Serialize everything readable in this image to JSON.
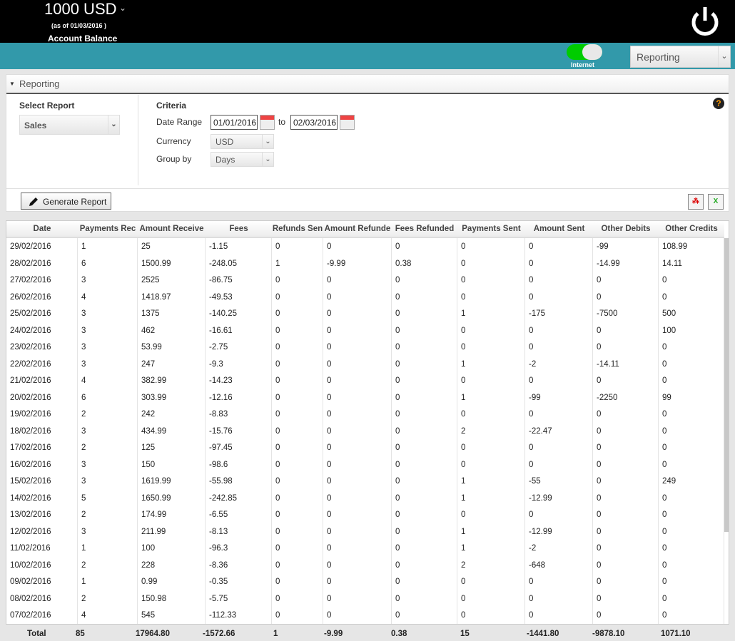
{
  "header": {
    "balance": "1000 USD",
    "as_of": "(as of 01/03/2016 )",
    "balance_label": "Account Balance",
    "internet_label": "Internet",
    "internet_on": true,
    "nav_select": "Reporting"
  },
  "panel": {
    "title": "Reporting",
    "select_report_label": "Select Report",
    "report": "Sales",
    "criteria_label": "Criteria",
    "date_range_label": "Date Range",
    "date_from": "01/01/2016",
    "to_label": "to",
    "date_to": "02/03/2016",
    "currency_label": "Currency",
    "currency": "USD",
    "group_by_label": "Group by",
    "group_by": "Days",
    "generate_label": "Generate Report",
    "help": "?"
  },
  "table": {
    "columns": [
      "Date",
      "Payments Rec",
      "Amount Receive",
      "Fees",
      "Refunds Sen",
      "Amount Refunde",
      "Fees Refunded",
      "Payments Sent",
      "Amount Sent",
      "Other Debits",
      "Other Credits"
    ],
    "rows": [
      [
        "29/02/2016",
        "1",
        "25",
        "-1.15",
        "0",
        "0",
        "0",
        "0",
        "0",
        "-99",
        "108.99"
      ],
      [
        "28/02/2016",
        "6",
        "1500.99",
        "-248.05",
        "1",
        "-9.99",
        "0.38",
        "0",
        "0",
        "-14.99",
        "14.11"
      ],
      [
        "27/02/2016",
        "3",
        "2525",
        "-86.75",
        "0",
        "0",
        "0",
        "0",
        "0",
        "0",
        "0"
      ],
      [
        "26/02/2016",
        "4",
        "1418.97",
        "-49.53",
        "0",
        "0",
        "0",
        "0",
        "0",
        "0",
        "0"
      ],
      [
        "25/02/2016",
        "3",
        "1375",
        "-140.25",
        "0",
        "0",
        "0",
        "1",
        "-175",
        "-7500",
        "500"
      ],
      [
        "24/02/2016",
        "3",
        "462",
        "-16.61",
        "0",
        "0",
        "0",
        "0",
        "0",
        "0",
        "100"
      ],
      [
        "23/02/2016",
        "3",
        "53.99",
        "-2.75",
        "0",
        "0",
        "0",
        "0",
        "0",
        "0",
        "0"
      ],
      [
        "22/02/2016",
        "3",
        "247",
        "-9.3",
        "0",
        "0",
        "0",
        "1",
        "-2",
        "-14.11",
        "0"
      ],
      [
        "21/02/2016",
        "4",
        "382.99",
        "-14.23",
        "0",
        "0",
        "0",
        "0",
        "0",
        "0",
        "0"
      ],
      [
        "20/02/2016",
        "6",
        "303.99",
        "-12.16",
        "0",
        "0",
        "0",
        "1",
        "-99",
        "-2250",
        "99"
      ],
      [
        "19/02/2016",
        "2",
        "242",
        "-8.83",
        "0",
        "0",
        "0",
        "0",
        "0",
        "0",
        "0"
      ],
      [
        "18/02/2016",
        "3",
        "434.99",
        "-15.76",
        "0",
        "0",
        "0",
        "2",
        "-22.47",
        "0",
        "0"
      ],
      [
        "17/02/2016",
        "2",
        "125",
        "-97.45",
        "0",
        "0",
        "0",
        "0",
        "0",
        "0",
        "0"
      ],
      [
        "16/02/2016",
        "3",
        "150",
        "-98.6",
        "0",
        "0",
        "0",
        "0",
        "0",
        "0",
        "0"
      ],
      [
        "15/02/2016",
        "3",
        "1619.99",
        "-55.98",
        "0",
        "0",
        "0",
        "1",
        "-55",
        "0",
        "249"
      ],
      [
        "14/02/2016",
        "5",
        "1650.99",
        "-242.85",
        "0",
        "0",
        "0",
        "1",
        "-12.99",
        "0",
        "0"
      ],
      [
        "13/02/2016",
        "2",
        "174.99",
        "-6.55",
        "0",
        "0",
        "0",
        "0",
        "0",
        "0",
        "0"
      ],
      [
        "12/02/2016",
        "3",
        "211.99",
        "-8.13",
        "0",
        "0",
        "0",
        "1",
        "-12.99",
        "0",
        "0"
      ],
      [
        "11/02/2016",
        "1",
        "100",
        "-96.3",
        "0",
        "0",
        "0",
        "1",
        "-2",
        "0",
        "0"
      ],
      [
        "10/02/2016",
        "2",
        "228",
        "-8.36",
        "0",
        "0",
        "0",
        "2",
        "-648",
        "0",
        "0"
      ],
      [
        "09/02/2016",
        "1",
        "0.99",
        "-0.35",
        "0",
        "0",
        "0",
        "0",
        "0",
        "0",
        "0"
      ],
      [
        "08/02/2016",
        "2",
        "150.98",
        "-5.75",
        "0",
        "0",
        "0",
        "0",
        "0",
        "0",
        "0"
      ],
      [
        "07/02/2016",
        "4",
        "545",
        "-112.33",
        "0",
        "0",
        "0",
        "0",
        "0",
        "0",
        "0"
      ]
    ],
    "totals": [
      "Total",
      "85",
      "17964.80",
      "-1572.66",
      "1",
      "-9.99",
      "0.38",
      "15",
      "-1441.80",
      "-9878.10",
      "1071.10"
    ]
  },
  "colors": {
    "topbar": "#000000",
    "teal": "#3299aa",
    "toggle_on": "#00cc00",
    "help_accent": "#ff9900"
  }
}
